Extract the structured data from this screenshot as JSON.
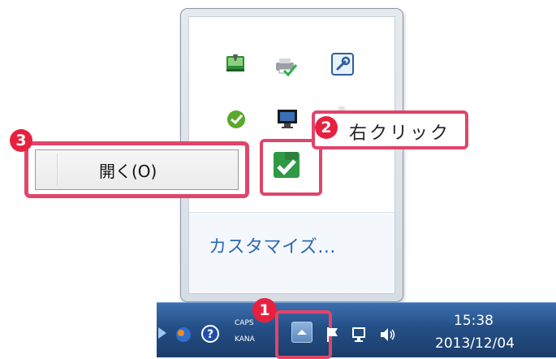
{
  "tray_popup": {
    "icons": [
      {
        "name": "sync-status-icon",
        "desc": "green device"
      },
      {
        "name": "printer-check-icon",
        "desc": "printer with check"
      },
      {
        "name": "wrench-icon",
        "desc": "blue wrench"
      },
      {
        "name": "chat-icon",
        "desc": "green bubble"
      },
      {
        "name": "monitor-icon",
        "desc": "display"
      },
      {
        "name": "app-check-icon",
        "desc": "green check"
      }
    ],
    "customize_label": "カスタマイズ..."
  },
  "callouts": {
    "step1": "1",
    "step2": "2",
    "step3": "3",
    "right_click_label": "右クリック"
  },
  "context_menu": {
    "items": [
      {
        "label": "開く(O)"
      }
    ]
  },
  "taskbar": {
    "caps_label": "CAPS",
    "kana_label": "KANA",
    "clock_time": "15:38",
    "clock_date": "2013/12/04"
  },
  "colors": {
    "highlight": "#e0456a",
    "badge": "#e8203f",
    "taskbar": "#244f86",
    "link": "#2c6bb5"
  }
}
